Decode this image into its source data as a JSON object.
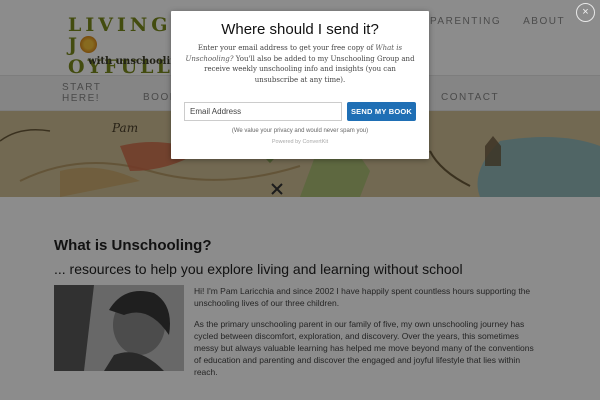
{
  "header": {
    "logo": {
      "line1": "LIVING",
      "line2_o": "J",
      "line2_rest": "OYFULLY",
      "subtitle": "with unschooling"
    },
    "top_nav": [
      {
        "label": "PARENTING"
      },
      {
        "label": "ABOUT"
      }
    ]
  },
  "main_nav": {
    "start_here": "START HERE!",
    "books": "BOOK",
    "contact": "CONTACT"
  },
  "banner": {
    "caption": "Pam"
  },
  "content": {
    "title": "What is Unschooling?",
    "subtitle": "... resources to help you explore living and learning without school",
    "paragraph1": "Hi! I'm Pam Laricchia and since 2002 I have happily spent countless hours supporting the unschooling lives of our three children.",
    "paragraph2": "As the primary unschooling parent in our family of five, my own unschooling journey has cycled between discomfort, exploration, and discovery. Over the years, this sometimes messy but always valuable learning has helped me move beyond many of the conventions of education and parenting and discover the engaged and joyful lifestyle that lies within reach."
  },
  "modal": {
    "close_symbol": "×",
    "title": "Where should I send it?",
    "desc_prefix": "Enter your email address to get your free copy of ",
    "desc_book": "What is Unschooling?",
    "desc_suffix": " You'll also be added to my Unschooling Group and receive weekly unschooling info and insights (you can unsubscribe at any time).",
    "email_placeholder": "Email Address",
    "submit_label": "SEND MY BOOK",
    "privacy": "(We value your privacy and would never spam you)",
    "powered": "Powered by ConvertKit"
  },
  "colors": {
    "logo_green": "#7a8a1c",
    "button_blue": "#1f6fb5",
    "overlay": "rgba(0,0,0,0.45)"
  }
}
